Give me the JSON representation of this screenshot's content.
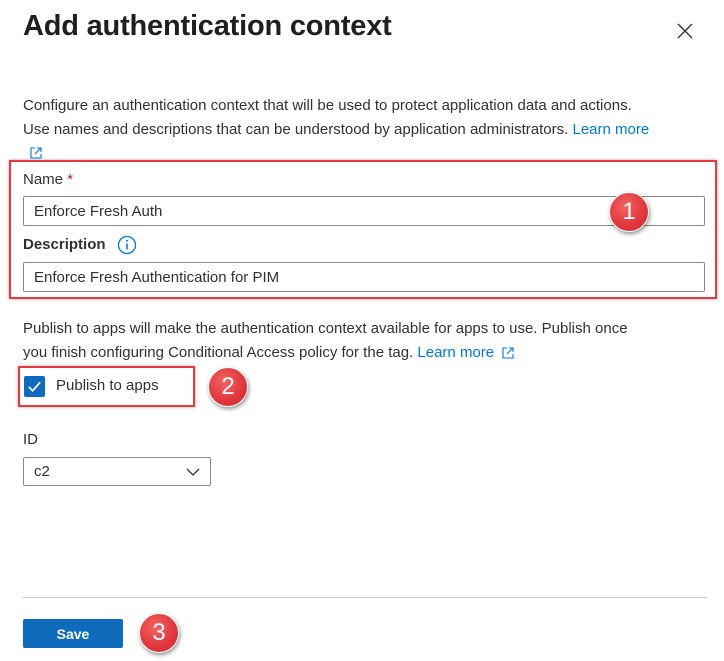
{
  "panel": {
    "title": "Add authentication context",
    "close_icon": "close-icon"
  },
  "intro": {
    "line1": "Configure an authentication context that will be used to protect application data and actions.",
    "line2": "Use names and descriptions that can be understood by application administrators.",
    "learn_more": "Learn more"
  },
  "form": {
    "name_label": "Name",
    "required_mark": "*",
    "name_value": "Enforce Fresh Auth",
    "description_label": "Description",
    "description_value": "Enforce Fresh Authentication for PIM"
  },
  "publish": {
    "description_line1": "Publish to apps will make the authentication context available for apps to use. Publish once",
    "description_line2": "you finish configuring Conditional Access policy for the tag.",
    "learn_more": "Learn more",
    "checkbox_label": "Publish to apps",
    "checked": true
  },
  "id_field": {
    "label": "ID",
    "selected": "c2"
  },
  "footer": {
    "save_label": "Save"
  },
  "annotations": {
    "step1": "1",
    "step2": "2",
    "step3": "3",
    "highlight_color": "#e8393f"
  },
  "colors": {
    "accent": "#0f6cbd",
    "link": "#0078d4"
  }
}
